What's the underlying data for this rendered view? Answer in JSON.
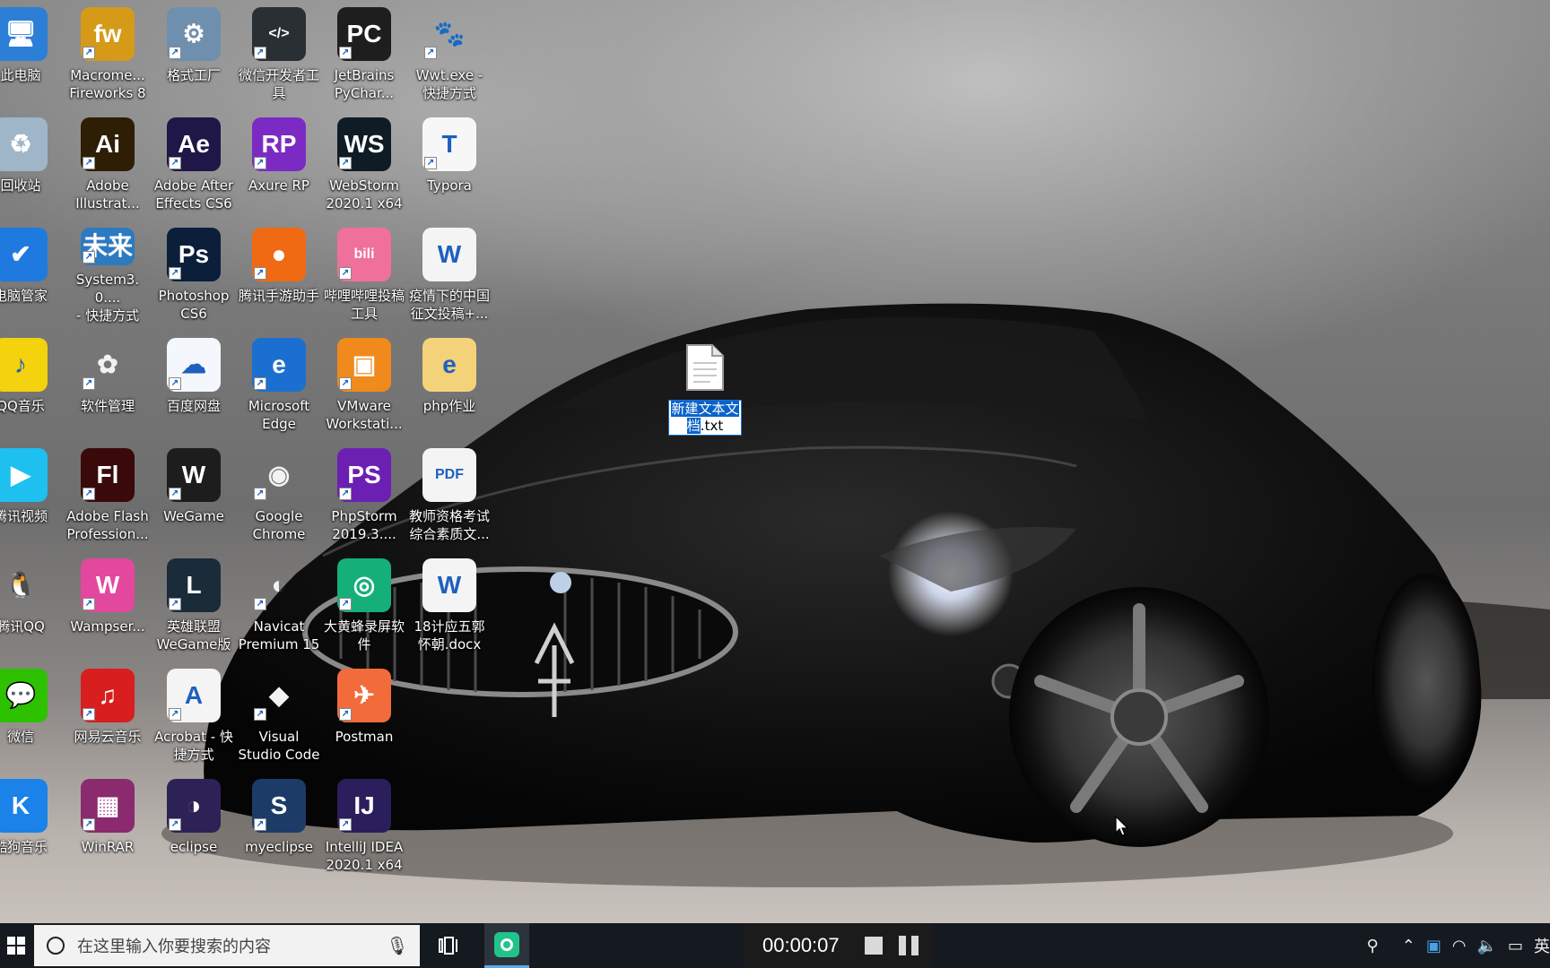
{
  "desktop": {
    "icons": [
      {
        "label": "此电脑",
        "icon": "this-pc-icon",
        "glyph": "🖥",
        "bg": "#2b7fd6",
        "shortcut": false
      },
      {
        "label": "Macrome...\nFireworks 8",
        "icon": "fireworks-icon",
        "glyph": "fw",
        "bg": "#d49a18",
        "shortcut": true
      },
      {
        "label": "格式工厂",
        "icon": "format-factory-icon",
        "glyph": "⚙",
        "bg": "#6f8fae",
        "shortcut": true
      },
      {
        "label": "微信开发者工\n具",
        "icon": "wechat-devtools-icon",
        "glyph": "</>",
        "bg": "#2a2f33",
        "shortcut": true
      },
      {
        "label": "JetBrains\nPyChar...",
        "icon": "pycharm-icon",
        "glyph": "PC",
        "bg": "#1e1e1e",
        "shortcut": true
      },
      {
        "label": "Wwt.exe -\n快捷方式",
        "icon": "paw-icon",
        "glyph": "🐾",
        "bg": "transparent",
        "shortcut": true
      },
      {
        "label": "回收站",
        "icon": "recycle-bin-icon",
        "glyph": "♻",
        "bg": "#9fb6c8",
        "shortcut": false
      },
      {
        "label": "Adobe\nIllustrat...",
        "icon": "illustrator-icon",
        "glyph": "Ai",
        "bg": "#2e1e05",
        "shortcut": true
      },
      {
        "label": "Adobe After\nEffects CS6",
        "icon": "after-effects-icon",
        "glyph": "Ae",
        "bg": "#1e1747",
        "shortcut": true
      },
      {
        "label": "Axure RP",
        "icon": "axure-icon",
        "glyph": "RP",
        "bg": "#7b2bc4",
        "shortcut": true
      },
      {
        "label": "WebStorm\n2020.1 x64",
        "icon": "webstorm-icon",
        "glyph": "WS",
        "bg": "#0f1c26",
        "shortcut": true
      },
      {
        "label": "Typora",
        "icon": "typora-icon",
        "glyph": "T",
        "bg": "#f7f7f7",
        "shortcut": true
      },
      {
        "label": "电脑管家",
        "icon": "pc-manager-icon",
        "glyph": "✔",
        "bg": "#1f7ae0",
        "shortcut": false
      },
      {
        "label": "System3.0....\n- 快捷方式",
        "icon": "future-globe-icon",
        "glyph": "未来",
        "bg": "#2c7abf",
        "shortcut": true
      },
      {
        "label": "Photoshop\nCS6",
        "icon": "photoshop-icon",
        "glyph": "Ps",
        "bg": "#0b1f3a",
        "shortcut": true
      },
      {
        "label": "腾讯手游助手",
        "icon": "tencent-game-assistant-icon",
        "glyph": "●",
        "bg": "#ef6a12",
        "shortcut": true
      },
      {
        "label": "哔哩哔哩投稿\n工具",
        "icon": "bilibili-icon",
        "glyph": "bili",
        "bg": "#f0709c",
        "shortcut": true
      },
      {
        "label": "疫情下的中国\n征文投稿+...",
        "icon": "word-doc-icon",
        "glyph": "W",
        "bg": "#f4f4f4",
        "shortcut": false
      },
      {
        "label": "QQ音乐",
        "icon": "qq-music-icon",
        "glyph": "♪",
        "bg": "#f4d20e",
        "shortcut": false
      },
      {
        "label": "软件管理",
        "icon": "software-manager-icon",
        "glyph": "✿",
        "bg": "transparent",
        "shortcut": true
      },
      {
        "label": "百度网盘",
        "icon": "baidu-netdisk-icon",
        "glyph": "☁",
        "bg": "#f4f8fc",
        "shortcut": true
      },
      {
        "label": "Microsoft\nEdge",
        "icon": "edge-icon",
        "glyph": "e",
        "bg": "#1b6fd0",
        "shortcut": true
      },
      {
        "label": "VMware\nWorkstati...",
        "icon": "vmware-icon",
        "glyph": "▣",
        "bg": "#f08a1c",
        "shortcut": true
      },
      {
        "label": "php作业",
        "icon": "folder-icon",
        "glyph": "e",
        "bg": "#f3d27a",
        "shortcut": false
      },
      {
        "label": "腾讯视频",
        "icon": "tencent-video-icon",
        "glyph": "▶",
        "bg": "#1ec0ef",
        "shortcut": false
      },
      {
        "label": "Adobe Flash\nProfession...",
        "icon": "flash-icon",
        "glyph": "Fl",
        "bg": "#3a0a0a",
        "shortcut": true
      },
      {
        "label": "WeGame",
        "icon": "wegame-icon",
        "glyph": "W",
        "bg": "#1d1d1d",
        "shortcut": true
      },
      {
        "label": "Google\nChrome",
        "icon": "chrome-icon",
        "glyph": "◉",
        "bg": "transparent",
        "shortcut": true
      },
      {
        "label": "PhpStorm\n2019.3....",
        "icon": "phpstorm-icon",
        "glyph": "PS",
        "bg": "#6b1fb3",
        "shortcut": true
      },
      {
        "label": "教师资格考试\n综合素质文...",
        "icon": "pdf-icon",
        "glyph": "PDF",
        "bg": "#f4f4f4",
        "shortcut": false
      },
      {
        "label": "腾讯QQ",
        "icon": "qq-icon",
        "glyph": "🐧",
        "bg": "transparent",
        "shortcut": false
      },
      {
        "label": "Wampser...",
        "icon": "wampserver-icon",
        "glyph": "W",
        "bg": "#e2489e",
        "shortcut": true
      },
      {
        "label": "英雄联盟\nWeGame版",
        "icon": "league-of-legends-icon",
        "glyph": "L",
        "bg": "#1a2b3a",
        "shortcut": true
      },
      {
        "label": "Navicat\nPremium 15",
        "icon": "navicat-icon",
        "glyph": "◐",
        "bg": "transparent",
        "shortcut": true
      },
      {
        "label": "大黄蜂录屏软\n件",
        "icon": "screen-recorder-icon",
        "glyph": "◎",
        "bg": "#15b07a",
        "shortcut": true
      },
      {
        "label": "18计应五郭\n怀朝.docx",
        "icon": "word-doc-icon-2",
        "glyph": "W",
        "bg": "#f4f4f4",
        "shortcut": false
      },
      {
        "label": "微信",
        "icon": "wechat-icon",
        "glyph": "💬",
        "bg": "#2dc100",
        "shortcut": false
      },
      {
        "label": "网易云音乐",
        "icon": "netease-music-icon",
        "glyph": "♫",
        "bg": "#d81e1e",
        "shortcut": true
      },
      {
        "label": "Acrobat - 快\n捷方式",
        "icon": "acrobat-icon",
        "glyph": "A",
        "bg": "#f4f4f4",
        "shortcut": true
      },
      {
        "label": "Visual\nStudio Code",
        "icon": "vscode-icon",
        "glyph": "◆",
        "bg": "transparent",
        "shortcut": true
      },
      {
        "label": "Postman",
        "icon": "postman-icon",
        "glyph": "✈",
        "bg": "#f26b3a",
        "shortcut": true
      },
      {
        "label": "酷狗音乐",
        "icon": "kugou-icon",
        "glyph": "K",
        "bg": "#1a82e8",
        "shortcut": false
      },
      {
        "label": "WinRAR",
        "icon": "winrar-icon",
        "glyph": "▦",
        "bg": "#8b2a6e",
        "shortcut": true
      },
      {
        "label": "eclipse",
        "icon": "eclipse-icon",
        "glyph": "◑",
        "bg": "#2c2255",
        "shortcut": true
      },
      {
        "label": "myeclipse",
        "icon": "myeclipse-icon",
        "glyph": "S",
        "bg": "#1c3b66",
        "shortcut": true
      },
      {
        "label": "IntelliJ IDEA\n2020.1 x64",
        "icon": "intellij-icon",
        "glyph": "IJ",
        "bg": "#2a1e5c",
        "shortcut": true
      }
    ],
    "renaming_file": {
      "icon": "text-file-icon",
      "name_selected": "新建文本文\n档",
      "name_rest": ".txt"
    }
  },
  "taskbar": {
    "search_placeholder": "在这里输入你要搜索的内容",
    "recorder_time": "00:00:07",
    "tray_language": "英"
  }
}
